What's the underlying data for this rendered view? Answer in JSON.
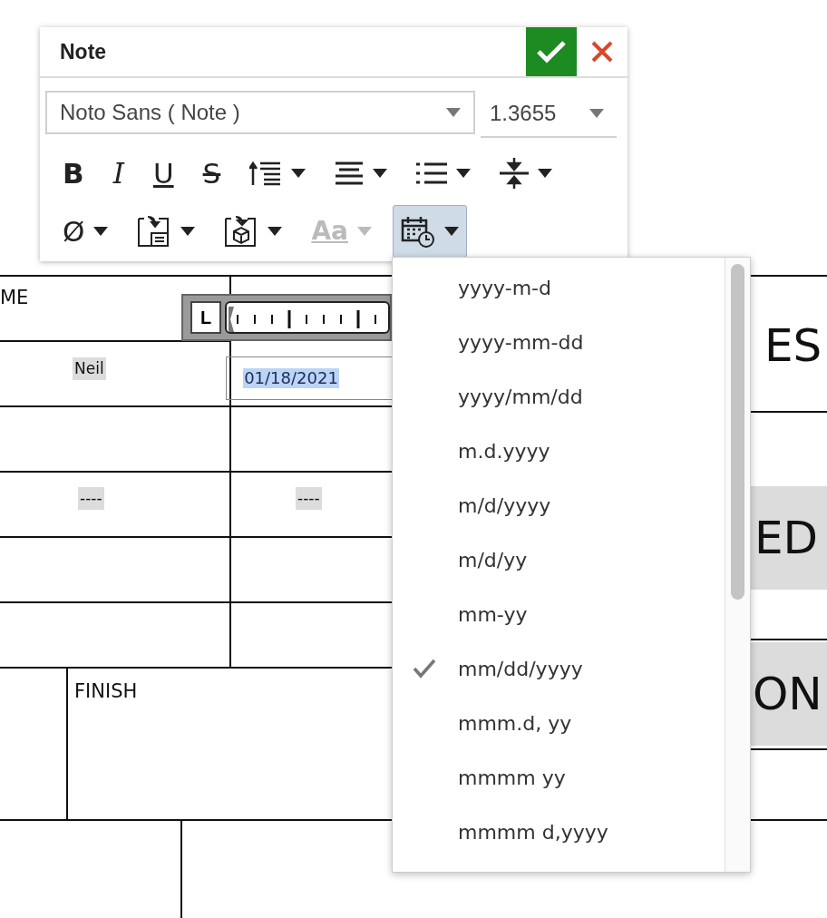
{
  "document": {
    "texts": [
      {
        "text": "ME",
        "kind": "label",
        "highlighted": false
      },
      {
        "text": "Neil",
        "kind": "value",
        "highlighted": true
      },
      {
        "text": "01/18/2021",
        "kind": "field",
        "highlighted": true
      },
      {
        "text": "----",
        "kind": "value",
        "highlighted": true
      },
      {
        "text": "----",
        "kind": "value",
        "highlighted": true
      },
      {
        "text": "FINISH",
        "kind": "label",
        "highlighted": false
      },
      {
        "text": "ES",
        "kind": "large",
        "highlighted": false
      },
      {
        "text": "ED",
        "kind": "large",
        "highlighted": true
      },
      {
        "text": "ON",
        "kind": "large",
        "highlighted": true
      }
    ],
    "ruler": {
      "tab_label": "L"
    }
  },
  "note_panel": {
    "title": "Note",
    "font": {
      "value": "Noto Sans ( Note )"
    },
    "size": {
      "value": "1.3655"
    },
    "toolbar_rows": [
      [
        {
          "kind": "bold",
          "text": "B",
          "caret": false,
          "disabled": false,
          "selected": false
        },
        {
          "kind": "italic",
          "text": "I",
          "caret": false,
          "disabled": false,
          "selected": false
        },
        {
          "kind": "underline",
          "text": "U",
          "caret": false,
          "disabled": false,
          "selected": false
        },
        {
          "kind": "strike",
          "text": "S",
          "caret": false,
          "disabled": false,
          "selected": false
        },
        {
          "kind": "line-spacing",
          "caret": true,
          "disabled": false,
          "selected": false
        },
        {
          "kind": "align",
          "caret": true,
          "disabled": false,
          "selected": false
        },
        {
          "kind": "list",
          "caret": true,
          "disabled": false,
          "selected": false
        },
        {
          "kind": "spacing",
          "caret": true,
          "disabled": false,
          "selected": false
        }
      ],
      [
        {
          "kind": "glyph",
          "text": "Ø",
          "caret": true,
          "disabled": false,
          "selected": false
        },
        {
          "kind": "insert-note",
          "caret": true,
          "disabled": false,
          "selected": false
        },
        {
          "kind": "insert-box",
          "caret": true,
          "disabled": false,
          "selected": false
        },
        {
          "kind": "case",
          "text": "Aa",
          "caret": true,
          "disabled": true,
          "selected": false
        },
        {
          "kind": "date",
          "caret": true,
          "disabled": false,
          "selected": true
        }
      ]
    ]
  },
  "format_menu": {
    "items": [
      {
        "label": "yyyy-m-d",
        "checked": false
      },
      {
        "label": "yyyy-mm-dd",
        "checked": false
      },
      {
        "label": "yyyy/mm/dd",
        "checked": false
      },
      {
        "label": "m.d.yyyy",
        "checked": false
      },
      {
        "label": "m/d/yyyy",
        "checked": false
      },
      {
        "label": "m/d/yy",
        "checked": false
      },
      {
        "label": "mm-yy",
        "checked": false
      },
      {
        "label": "mm/dd/yyyy",
        "checked": true
      },
      {
        "label": "mmm.d, yy",
        "checked": false
      },
      {
        "label": "mmmm yy",
        "checked": false
      },
      {
        "label": "mmmm d,yyyy",
        "checked": false
      }
    ]
  }
}
